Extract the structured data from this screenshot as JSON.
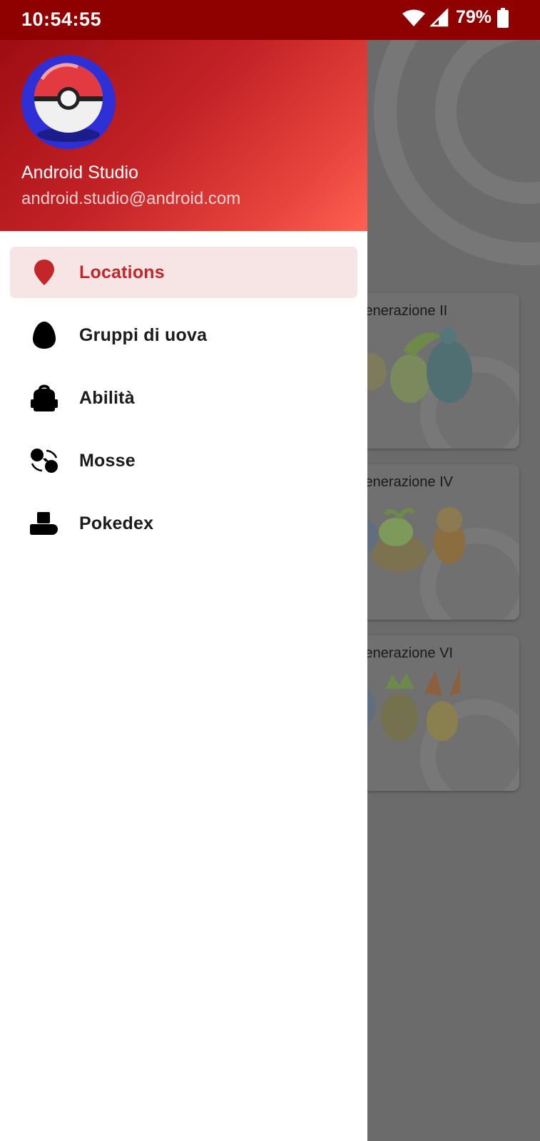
{
  "status_bar": {
    "time": "10:54:55",
    "battery": "79%"
  },
  "drawer": {
    "header": {
      "name": "Android Studio",
      "email": "android.studio@android.com"
    },
    "items": [
      {
        "label": "Locations",
        "icon": "location-pin-icon",
        "active": true
      },
      {
        "label": "Gruppi di uova",
        "icon": "egg-icon",
        "active": false
      },
      {
        "label": "Abilità",
        "icon": "backpack-icon",
        "active": false
      },
      {
        "label": "Mosse",
        "icon": "moves-icon",
        "active": false
      },
      {
        "label": "Pokedex",
        "icon": "pokedex-icon",
        "active": false
      }
    ]
  },
  "background": {
    "cards": [
      {
        "label": "Generazione II"
      },
      {
        "label": "Generazione IV"
      },
      {
        "label": "Generazione VI"
      }
    ]
  },
  "colors": {
    "status_bar": "#8f0000",
    "accent": "#c0262a",
    "active_item_bg": "#f7e5e6",
    "scrim": "#6b6b6b"
  }
}
